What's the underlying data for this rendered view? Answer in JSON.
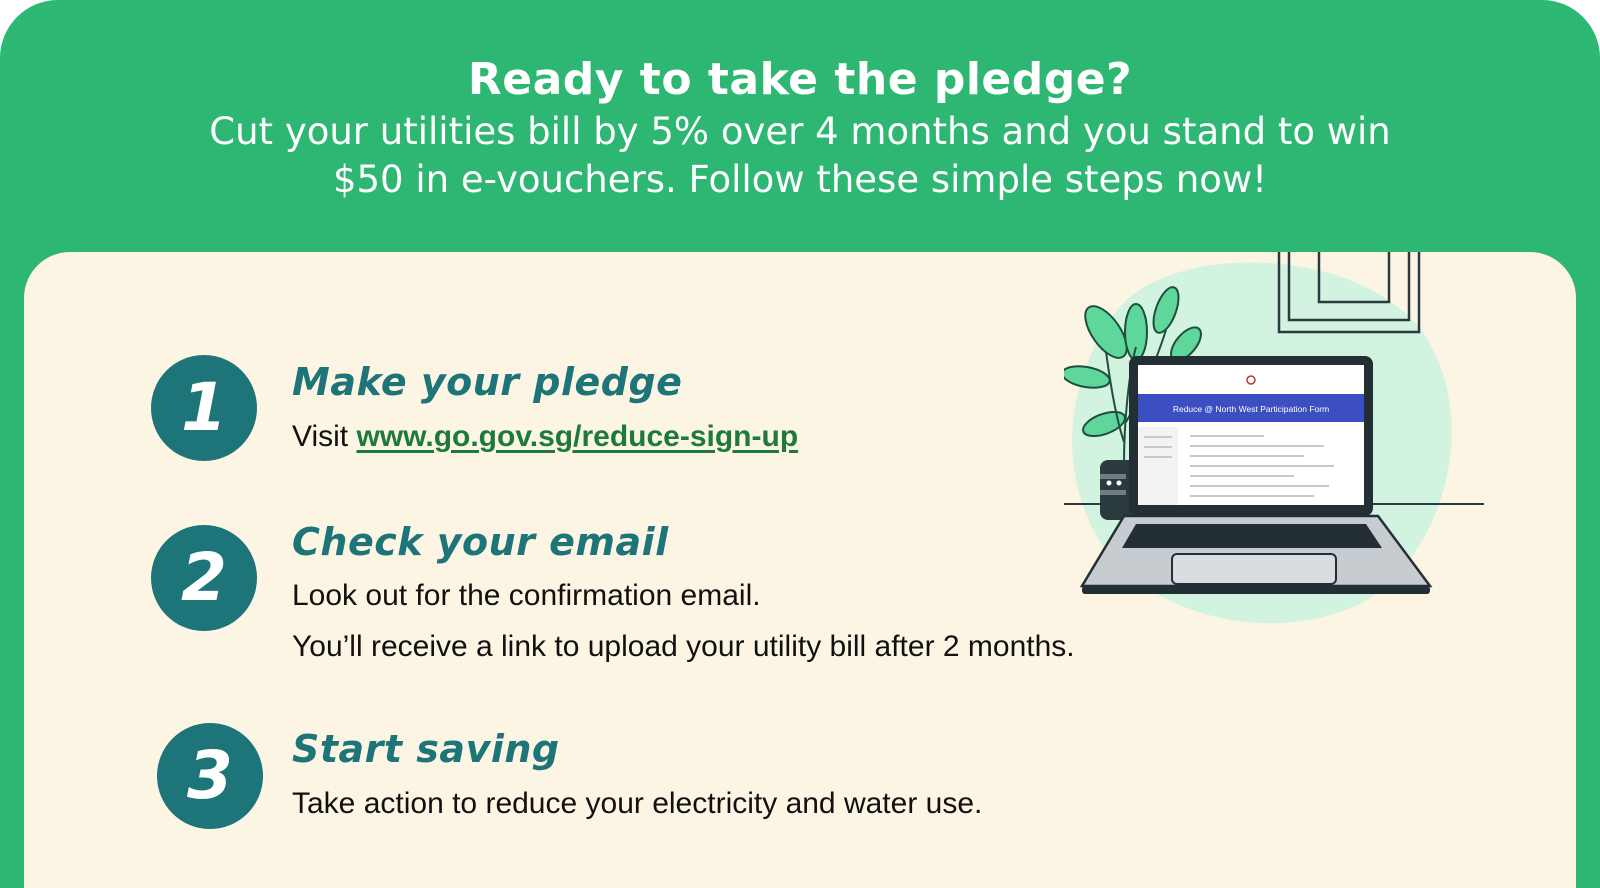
{
  "header": {
    "title": "Ready to take the pledge?",
    "subtitle": "Cut your utilities bill by 5% over 4 months and you stand to win $50 in e-vouchers. Follow these simple steps now!"
  },
  "steps": [
    {
      "number": "1",
      "title": "Make your pledge",
      "text_prefix": "Visit ",
      "link": "www.go.gov.sg/reduce-sign-up"
    },
    {
      "number": "2",
      "title": "Check your email",
      "line1": "Look out for the confirmation email.",
      "line2": "You’ll receive a link to upload your utility bill after 2 months."
    },
    {
      "number": "3",
      "title": "Start saving",
      "line1": "Take action to reduce your electricity and water use."
    }
  ],
  "illustration": {
    "form_title": "Reduce @ North West Participation Form",
    "icon": "laptop-with-plant-icon"
  },
  "colors": {
    "green": "#2db773",
    "cream": "#fdf5e3",
    "teal": "#1d7479",
    "link": "#1d7a3a",
    "form_blue": "#3c4fc2"
  }
}
